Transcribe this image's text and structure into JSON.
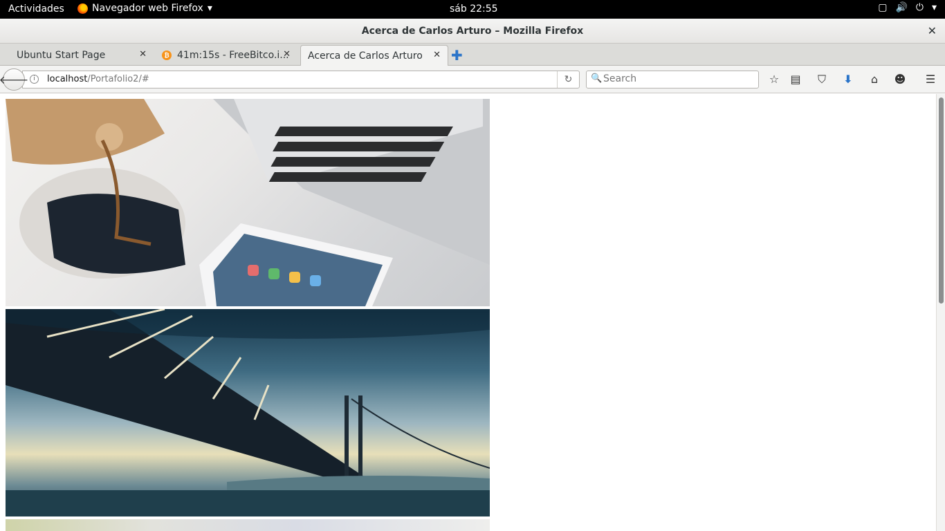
{
  "gnome": {
    "activities": "Actividades",
    "app_menu": "Navegador web Firefox",
    "clock": "sáb 22:55"
  },
  "window": {
    "title": "Acerca de Carlos Arturo – Mozilla Firefox"
  },
  "tabs": [
    {
      "label": "Ubuntu Start Page"
    },
    {
      "label": "41m:15s - FreeBitco.i..."
    },
    {
      "label": "Acerca de Carlos Arturo"
    }
  ],
  "address": {
    "host": "localhost",
    "path": "/Portafolio2/#"
  },
  "search": {
    "placeholder": "Search"
  },
  "colors": {
    "gnome_bar": "#000000",
    "download_accent": "#2a74c9"
  },
  "icons": {
    "bookmark": "star-icon",
    "reader": "clipboard-icon",
    "pocket": "pocket-icon",
    "downloads": "download-arrow-icon",
    "home": "home-icon",
    "hello": "chat-icon",
    "menu": "hamburger-icon"
  }
}
